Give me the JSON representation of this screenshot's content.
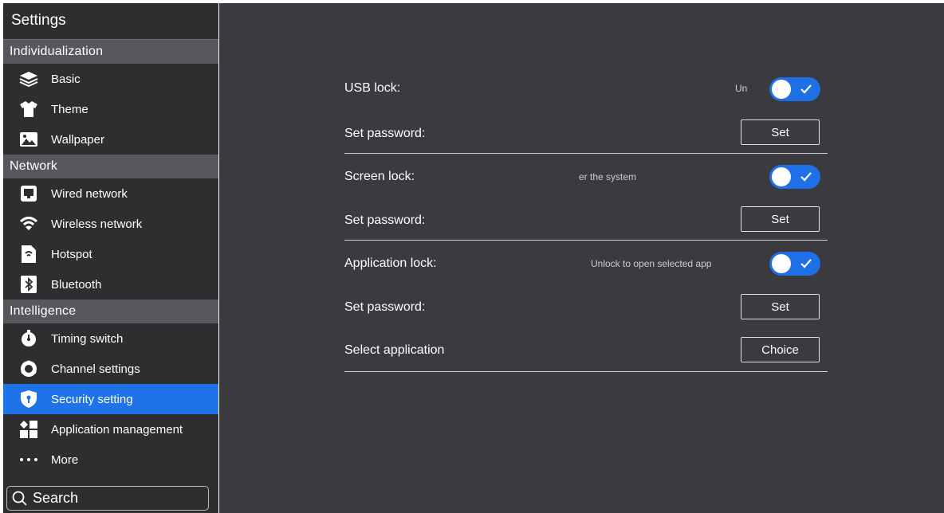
{
  "sidebar": {
    "title": "Settings",
    "groups": [
      {
        "label": "Individualization"
      },
      {
        "label": "Network"
      },
      {
        "label": "Intelligence"
      }
    ],
    "items": [
      {
        "label": "Basic",
        "icon": "layers-icon"
      },
      {
        "label": "Theme",
        "icon": "shirt-icon"
      },
      {
        "label": "Wallpaper",
        "icon": "image-icon"
      },
      {
        "label": "Wired network",
        "icon": "monitor-icon"
      },
      {
        "label": "Wireless network",
        "icon": "wifi-icon"
      },
      {
        "label": "Hotspot",
        "icon": "hotspot-icon"
      },
      {
        "label": "Bluetooth",
        "icon": "bluetooth-icon"
      },
      {
        "label": "Timing switch",
        "icon": "timer-icon"
      },
      {
        "label": "Channel settings",
        "icon": "channel-icon"
      },
      {
        "label": "Security setting",
        "icon": "shield-icon",
        "active": true
      },
      {
        "label": "Application management",
        "icon": "apps-icon"
      },
      {
        "label": "More",
        "icon": "more-icon"
      }
    ],
    "search_label": "Search"
  },
  "security": {
    "usb_lock": {
      "label": "USB lock:",
      "hint": "Un",
      "enabled": true
    },
    "usb_password": {
      "label": "Set password:",
      "button": "Set"
    },
    "screen_lock": {
      "label": "Screen lock:",
      "hint": "er the system",
      "enabled": true
    },
    "screen_password": {
      "label": "Set password:",
      "button": "Set"
    },
    "app_lock": {
      "label": "Application lock:",
      "hint": "Unlock to open selected app",
      "enabled": true
    },
    "app_password": {
      "label": "Set password:",
      "button": "Set"
    },
    "select_app": {
      "label": "Select application",
      "button": "Choice"
    }
  },
  "colors": {
    "accent": "#1e73e8",
    "sidebar_bg": "#2e2e31",
    "main_bg": "#3a3a3f",
    "group_bg": "#58585c"
  }
}
